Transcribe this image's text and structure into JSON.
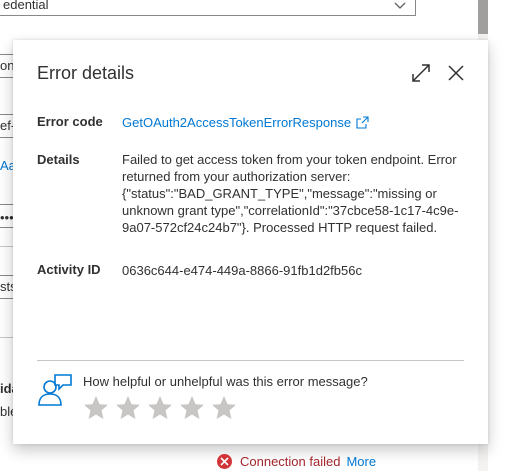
{
  "background": {
    "dropdown_value": "edential",
    "fragments": [
      {
        "id": "on",
        "text": "on"
      },
      {
        "id": "ef",
        "text": "ef-"
      },
      {
        "id": "aa",
        "text": "Aa"
      },
      {
        "id": "dots",
        "text": "•••"
      },
      {
        "id": "sts",
        "text": "sts"
      },
      {
        "id": "ida",
        "text": "ida"
      },
      {
        "id": "ble",
        "text": "ble"
      }
    ]
  },
  "callout": {
    "title": "Error details",
    "expand_label": "Expand",
    "close_label": "Close",
    "rows": {
      "error_code": {
        "label": "Error code",
        "value": "GetOAuth2AccessTokenErrorResponse"
      },
      "details": {
        "label": "Details",
        "value": "Failed to get access token from your token endpoint. Error returned from your authorization server: {\"status\":\"BAD_GRANT_TYPE\",\"message\":\"missing or unknown grant type\",\"correlationId\":\"37cbce58-1c17-4c9e-9a07-572cf24c24b7\"}. Processed HTTP request failed."
      },
      "activity_id": {
        "label": "Activity ID",
        "value": "0636c644-e474-449a-8866-91fb1d2fb56c"
      }
    },
    "feedback": {
      "question": "How helpful or unhelpful was this error message?",
      "rating": 0,
      "max_rating": 5
    }
  },
  "status": {
    "text": "Connection failed",
    "more": "More"
  },
  "colors": {
    "accent": "#0078d4",
    "error": "#d13438",
    "star": "#c8c6c4"
  }
}
